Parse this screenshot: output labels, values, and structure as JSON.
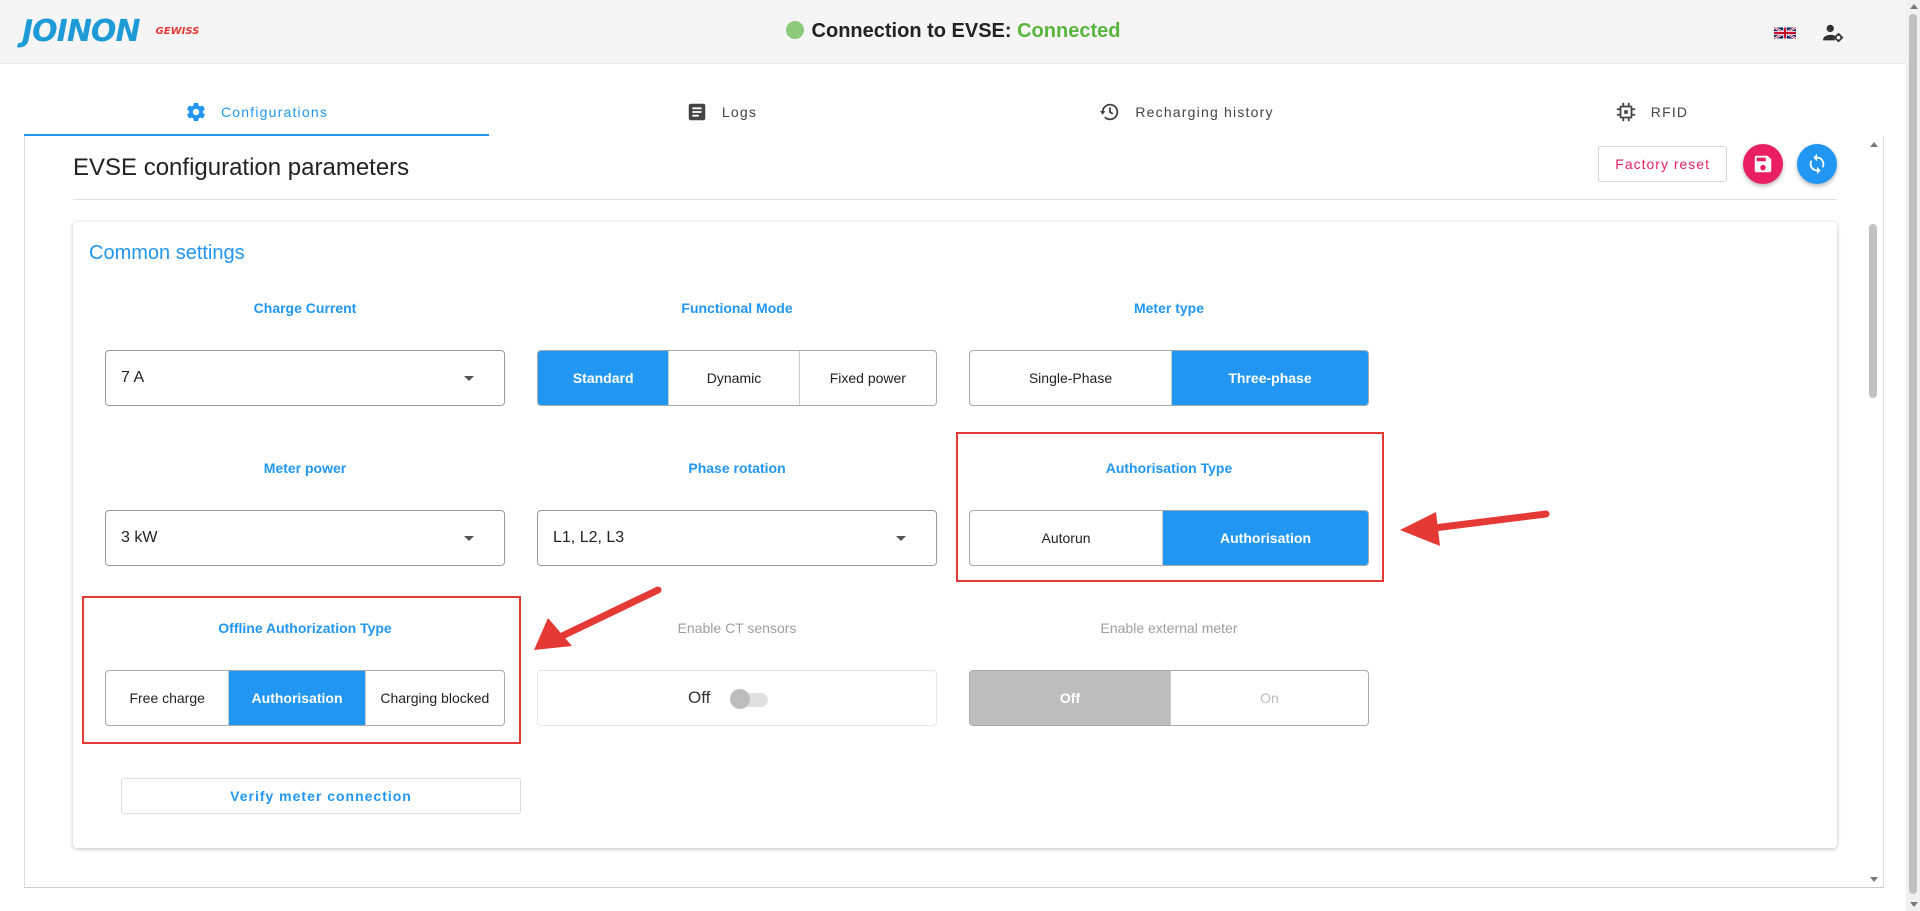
{
  "header": {
    "logo": "JOINON",
    "logo_sub": "GEWISS",
    "connection_label": "Connection to EVSE:",
    "connection_status": "Connected",
    "flag_icon": "uk-flag-icon",
    "user_icon": "user-settings-icon"
  },
  "tabs": [
    {
      "label": "Configurations",
      "icon": "gear-icon",
      "active": true
    },
    {
      "label": "Logs",
      "icon": "document-icon",
      "active": false
    },
    {
      "label": "Recharging history",
      "icon": "history-icon",
      "active": false
    },
    {
      "label": "RFID",
      "icon": "chip-icon",
      "active": false
    }
  ],
  "page": {
    "title": "EVSE configuration parameters",
    "factory_reset": "Factory reset"
  },
  "common": {
    "title": "Common settings",
    "charge_current": {
      "label": "Charge Current",
      "value": "7 A"
    },
    "functional_mode": {
      "label": "Functional Mode",
      "options": [
        "Standard",
        "Dynamic",
        "Fixed power"
      ],
      "selected": "Standard"
    },
    "meter_type": {
      "label": "Meter type",
      "options": [
        "Single-Phase",
        "Three-phase"
      ],
      "selected": "Three-phase"
    },
    "meter_power": {
      "label": "Meter power",
      "value": "3 kW"
    },
    "phase_rotation": {
      "label": "Phase rotation",
      "value": "L1, L2, L3"
    },
    "authorisation_type": {
      "label": "Authorisation Type",
      "options": [
        "Autorun",
        "Authorisation"
      ],
      "selected": "Authorisation"
    },
    "offline_auth": {
      "label": "Offline Authorization Type",
      "options": [
        "Free charge",
        "Authorisation",
        "Charging blocked"
      ],
      "selected": "Authorisation"
    },
    "ct_sensors": {
      "label": "Enable CT sensors",
      "state": "Off"
    },
    "external_meter": {
      "label": "Enable external meter",
      "options": [
        "Off",
        "On"
      ],
      "selected": "Off"
    },
    "verify_button": "Verify meter connection"
  },
  "colors": {
    "accent": "#2196f3",
    "danger": "#e91e63",
    "highlight": "#e53935",
    "connected": "#5ab53e"
  }
}
